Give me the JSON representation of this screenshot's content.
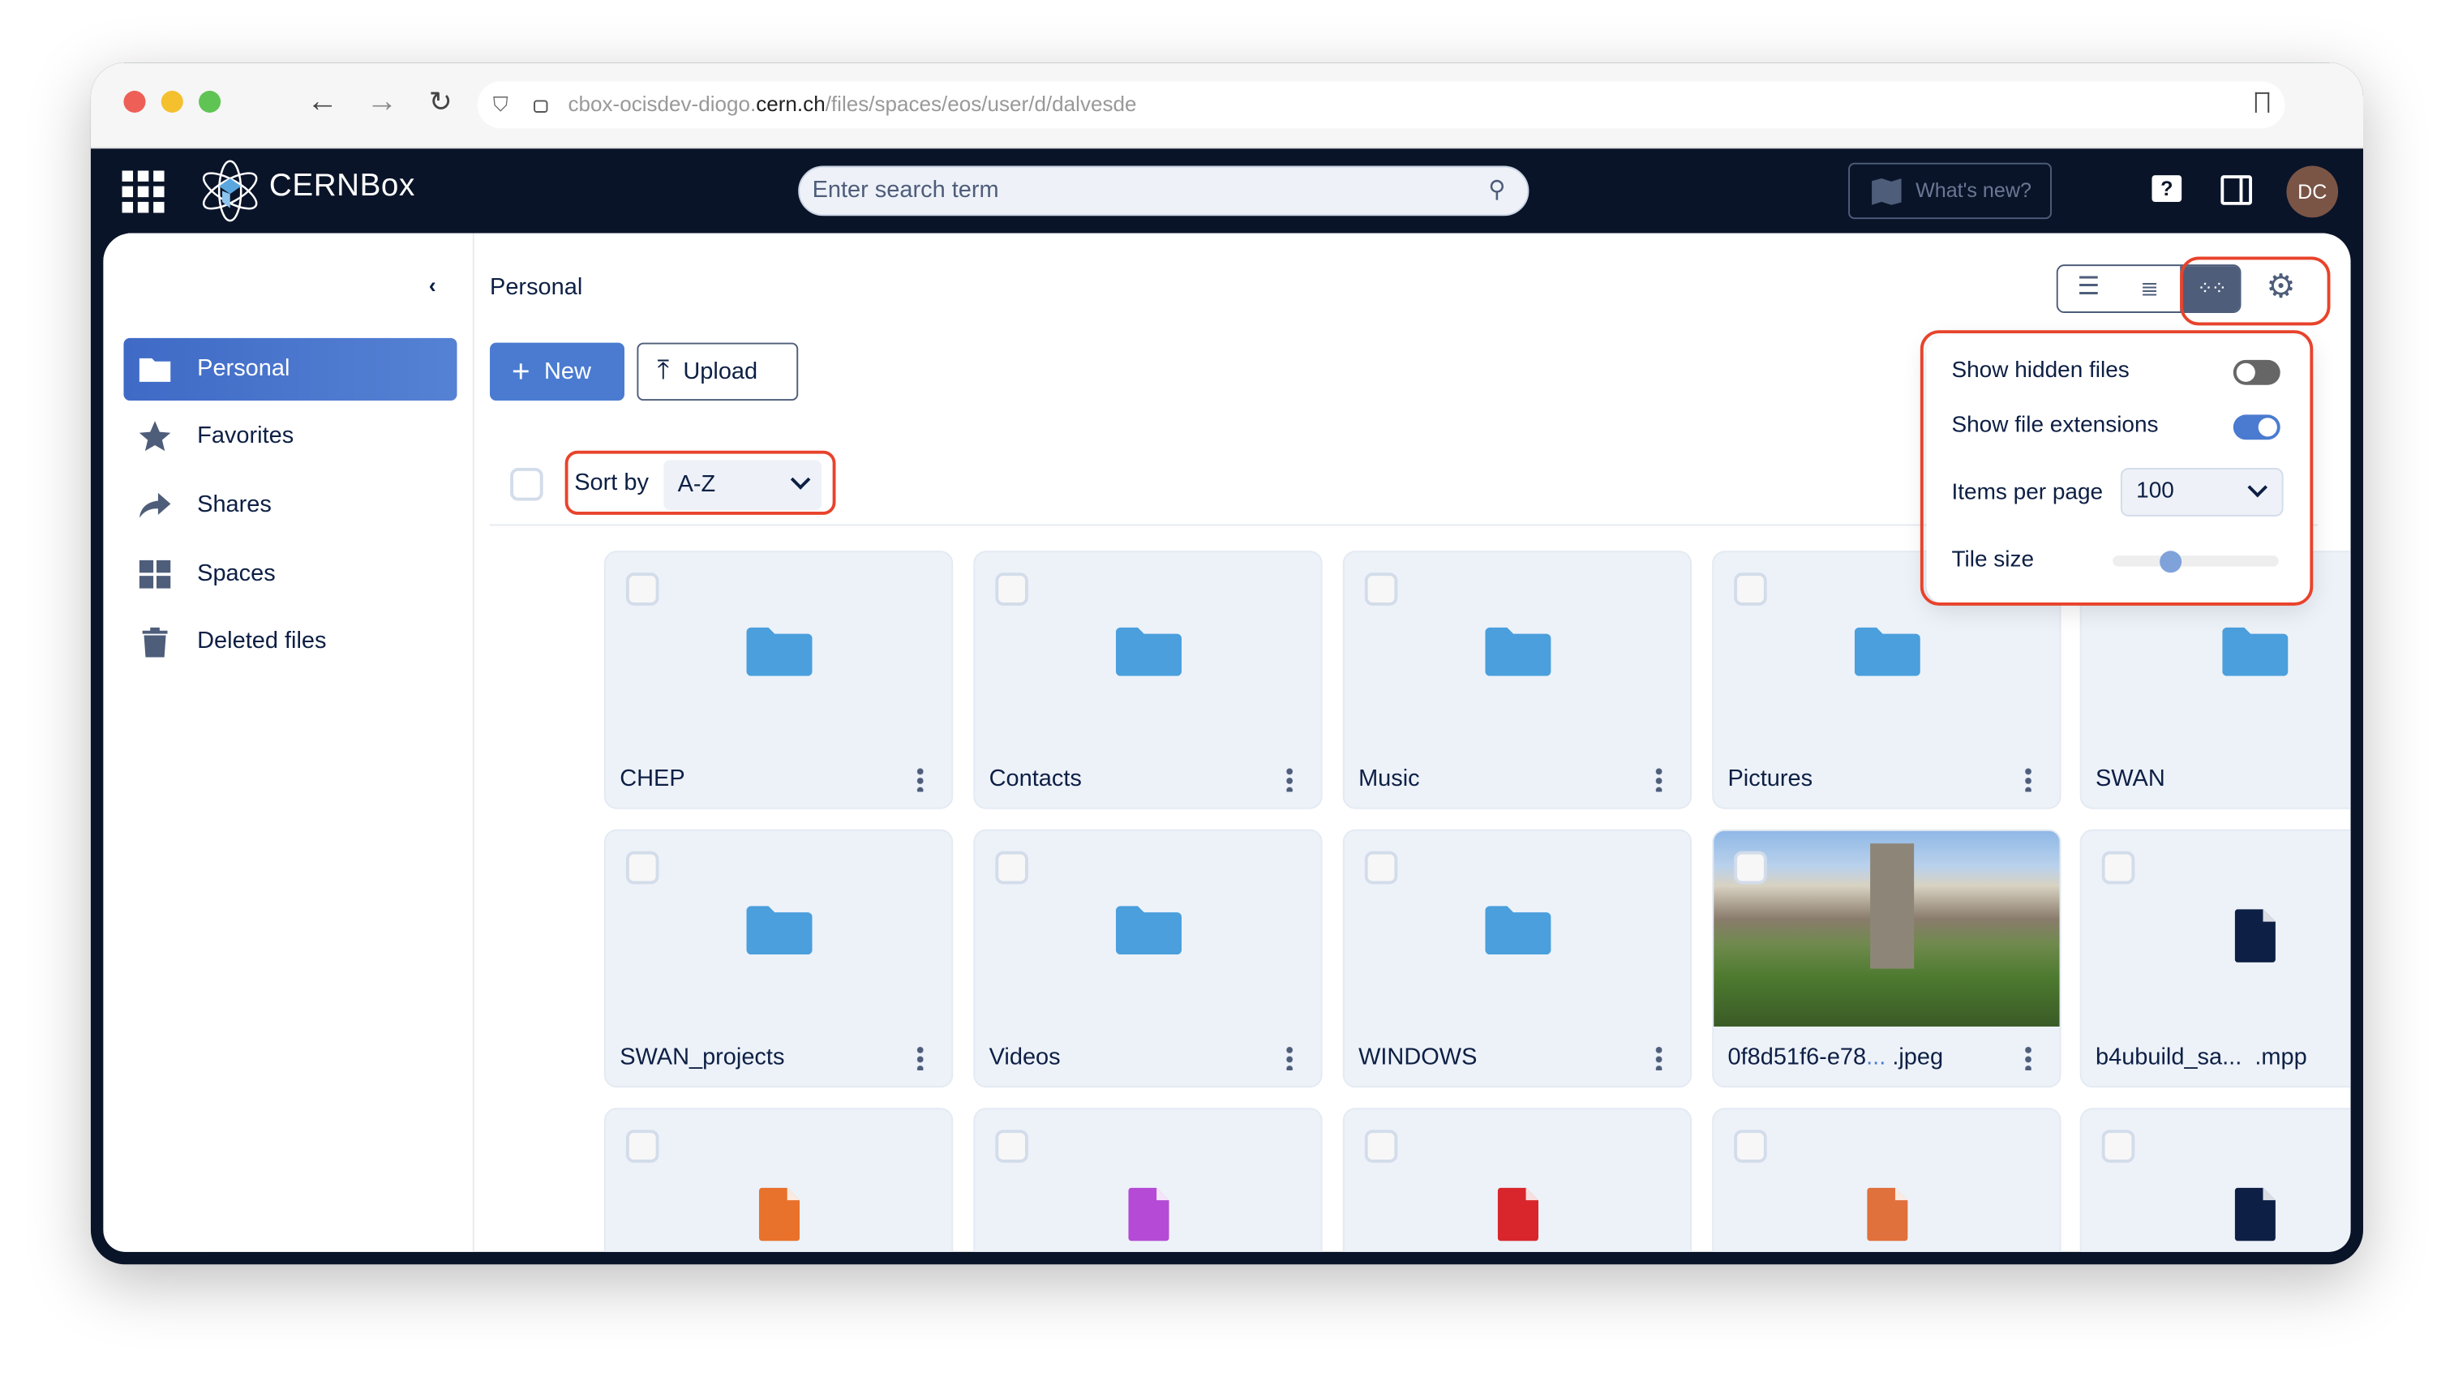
{
  "browser": {
    "url_host_prefix": "cbox-ocisdev-diogo.",
    "url_host": "cern.ch",
    "url_path": "/files/spaces/eos/user/d/dalvesde"
  },
  "appbar": {
    "brand": "CERNBox",
    "search_placeholder": "Enter search term",
    "whats_new": "What's new?",
    "avatar_initials": "DC"
  },
  "sidebar": {
    "items": [
      {
        "label": "Personal",
        "icon": "folder-icon",
        "active": true
      },
      {
        "label": "Favorites",
        "icon": "star-icon"
      },
      {
        "label": "Shares",
        "icon": "share-icon"
      },
      {
        "label": "Spaces",
        "icon": "spaces-grid-icon"
      },
      {
        "label": "Deleted files",
        "icon": "trash-icon"
      }
    ]
  },
  "main": {
    "breadcrumb": "Personal",
    "new_label": "New",
    "upload_label": "Upload",
    "sort_label": "Sort by",
    "sort_value": "A-Z"
  },
  "settings": {
    "show_hidden_label": "Show hidden files",
    "show_hidden": false,
    "show_ext_label": "Show file extensions",
    "show_ext": true,
    "items_per_page_label": "Items per page",
    "items_per_page": "100",
    "tile_size_label": "Tile size",
    "tile_size_fraction": 0.35
  },
  "colors": {
    "accent": "#4a7bd0",
    "dark": "#0a1429",
    "highlight": "#e8432b",
    "folder": "#4a9fdc"
  },
  "tiles": [
    {
      "name": "CHEP",
      "type": "folder"
    },
    {
      "name": "Contacts",
      "type": "folder"
    },
    {
      "name": "Music",
      "type": "folder"
    },
    {
      "name": "Pictures",
      "type": "folder"
    },
    {
      "name": "SWAN",
      "type": "folder"
    },
    {
      "name": "SWAN_projects",
      "type": "folder"
    },
    {
      "name": "Videos",
      "type": "folder"
    },
    {
      "name": "WINDOWS",
      "type": "folder"
    },
    {
      "name": "0f8d51f6-e78",
      "ellipsis": "...",
      "ext": " .jpeg",
      "type": "image"
    },
    {
      "name": "b4ubuild_sa...",
      "ellipsis": "",
      "ext": "  .mpp",
      "type": "file",
      "icon": "file-icon",
      "color": "#0d1f44"
    },
    {
      "name": "",
      "type": "file",
      "icon": "spreadsheet-file-icon",
      "color": "#e8722c"
    },
    {
      "name": "",
      "type": "file",
      "icon": "diagram-file-icon",
      "color": "#b54ad6"
    },
    {
      "name": "",
      "type": "file",
      "icon": "pdf-file-icon",
      "color": "#d8262c"
    },
    {
      "name": "",
      "type": "file",
      "icon": "presentation-file-icon",
      "color": "#e0703c"
    },
    {
      "name": "",
      "type": "file",
      "icon": "code-file-icon",
      "color": "#0d1f44"
    }
  ]
}
